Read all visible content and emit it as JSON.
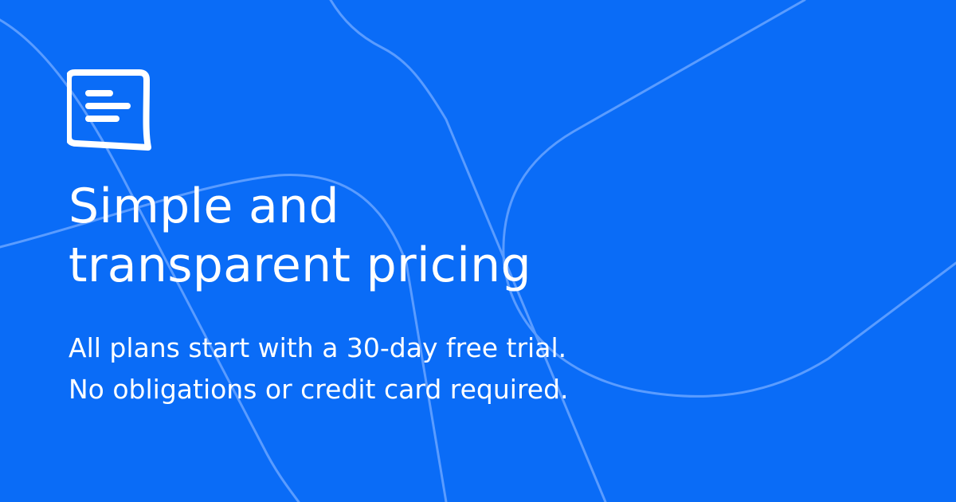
{
  "colors": {
    "background": "#0a6cf7",
    "text": "#ffffff",
    "decorative_lines": "#5a9cff"
  },
  "logo": {
    "icon": "chat-bubble-text-icon"
  },
  "headline": {
    "line1": "Simple and",
    "line2": "transparent pricing"
  },
  "subtitle": {
    "line1": "All plans start with a 30-day free trial.",
    "line2": "No obligations or credit card required."
  }
}
